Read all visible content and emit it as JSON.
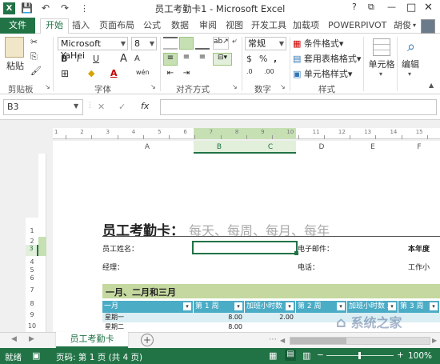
{
  "window": {
    "title": "员工考勤卡1 - Microsoft Excel",
    "app_icon": "X",
    "help": "?",
    "quick_access": {
      "save": "💾",
      "undo": "↶",
      "redo": "↷",
      "customize": "⋮"
    },
    "controls": {
      "restore": "⧉",
      "minimize": "—",
      "maximize": "□",
      "close": "✕"
    }
  },
  "tabs": {
    "file": "文件",
    "items": [
      "开始",
      "插入",
      "页面布局",
      "公式",
      "数据",
      "审阅",
      "视图",
      "开发工具",
      "加载项",
      "POWERPIVOT"
    ],
    "user": "胡俊",
    "user_arrow": "▾"
  },
  "ribbon": {
    "clipboard": {
      "paste": "粘贴",
      "label": "剪贴板",
      "cut": "✂",
      "copy": "⎘",
      "format_painter": "🖌",
      "launcher": "↘"
    },
    "font": {
      "name": "Microsoft YaHei",
      "size": "8",
      "label": "字体",
      "bold": "B",
      "italic": "I",
      "underline": "U",
      "grow": "A",
      "shrink": "A",
      "borders": "⊞",
      "fill": "◆",
      "font_color": "A",
      "phonetic": "wén",
      "launcher": "↘"
    },
    "alignment": {
      "label": "对齐方式",
      "launcher": "↘"
    },
    "number": {
      "format": "常规",
      "label": "数字",
      "currency": "$",
      "percent": "%",
      "comma": ",",
      "inc_decimal": ".0",
      "dec_decimal": ".00",
      "launcher": "↘"
    },
    "styles": {
      "conditional": "条件格式",
      "table": "套用表格格式",
      "cell": "单元格样式",
      "label": "样式"
    },
    "cells": {
      "label": "单元格"
    },
    "editing": {
      "label": "编辑"
    },
    "collapse": "▲"
  },
  "formula_bar": {
    "name_box": "B3",
    "cancel": "✕",
    "enter": "✓",
    "fx": "fx",
    "value": ""
  },
  "ruler": {
    "marks": [
      "1",
      "2",
      "3",
      "4",
      "5",
      "6",
      "7",
      "8",
      "9",
      "10",
      "11",
      "12",
      "13",
      "14",
      "15"
    ]
  },
  "columns": [
    "A",
    "B",
    "C",
    "D",
    "E",
    "F"
  ],
  "rows": [
    "1",
    "2",
    "3",
    "4",
    "5",
    "6",
    "7",
    "8",
    "9",
    "10"
  ],
  "sheet": {
    "title": "员工考勤卡：",
    "subtitle": "每天、每周、每月、每年",
    "employee_name_label": "员工姓名：",
    "email_label": "电子邮件：",
    "year_label": "本年度",
    "manager_label": "经理：",
    "phone_label": "电话：",
    "work_label": "工作小",
    "section": "一月、二月和三月",
    "table_headers": [
      "一月",
      "第 1 周",
      "加班小时数",
      "第 2 周",
      "加班小时数 2",
      "第 3 周"
    ],
    "header_dropdown": "▾",
    "table_rows": [
      [
        "星期一",
        "8.00",
        "2.00",
        "",
        "",
        ""
      ],
      [
        "星期二",
        "8.00",
        "",
        "",
        "",
        ""
      ]
    ]
  },
  "sheet_tabs": {
    "active": "员工考勤卡",
    "add": "+",
    "prev": "◀",
    "next": "▶",
    "menu": "⋯"
  },
  "status": {
    "ready": "就绪",
    "page": "页码: 第 1 页 (共 4 页)",
    "zoom": "100%",
    "zoom_minus": "−",
    "zoom_plus": "+"
  },
  "watermark": "系统之家",
  "colors": {
    "accent": "#217346",
    "table_header": "#4bacc6",
    "section_band": "#c4d89f",
    "row_band": "#dbeef3"
  }
}
